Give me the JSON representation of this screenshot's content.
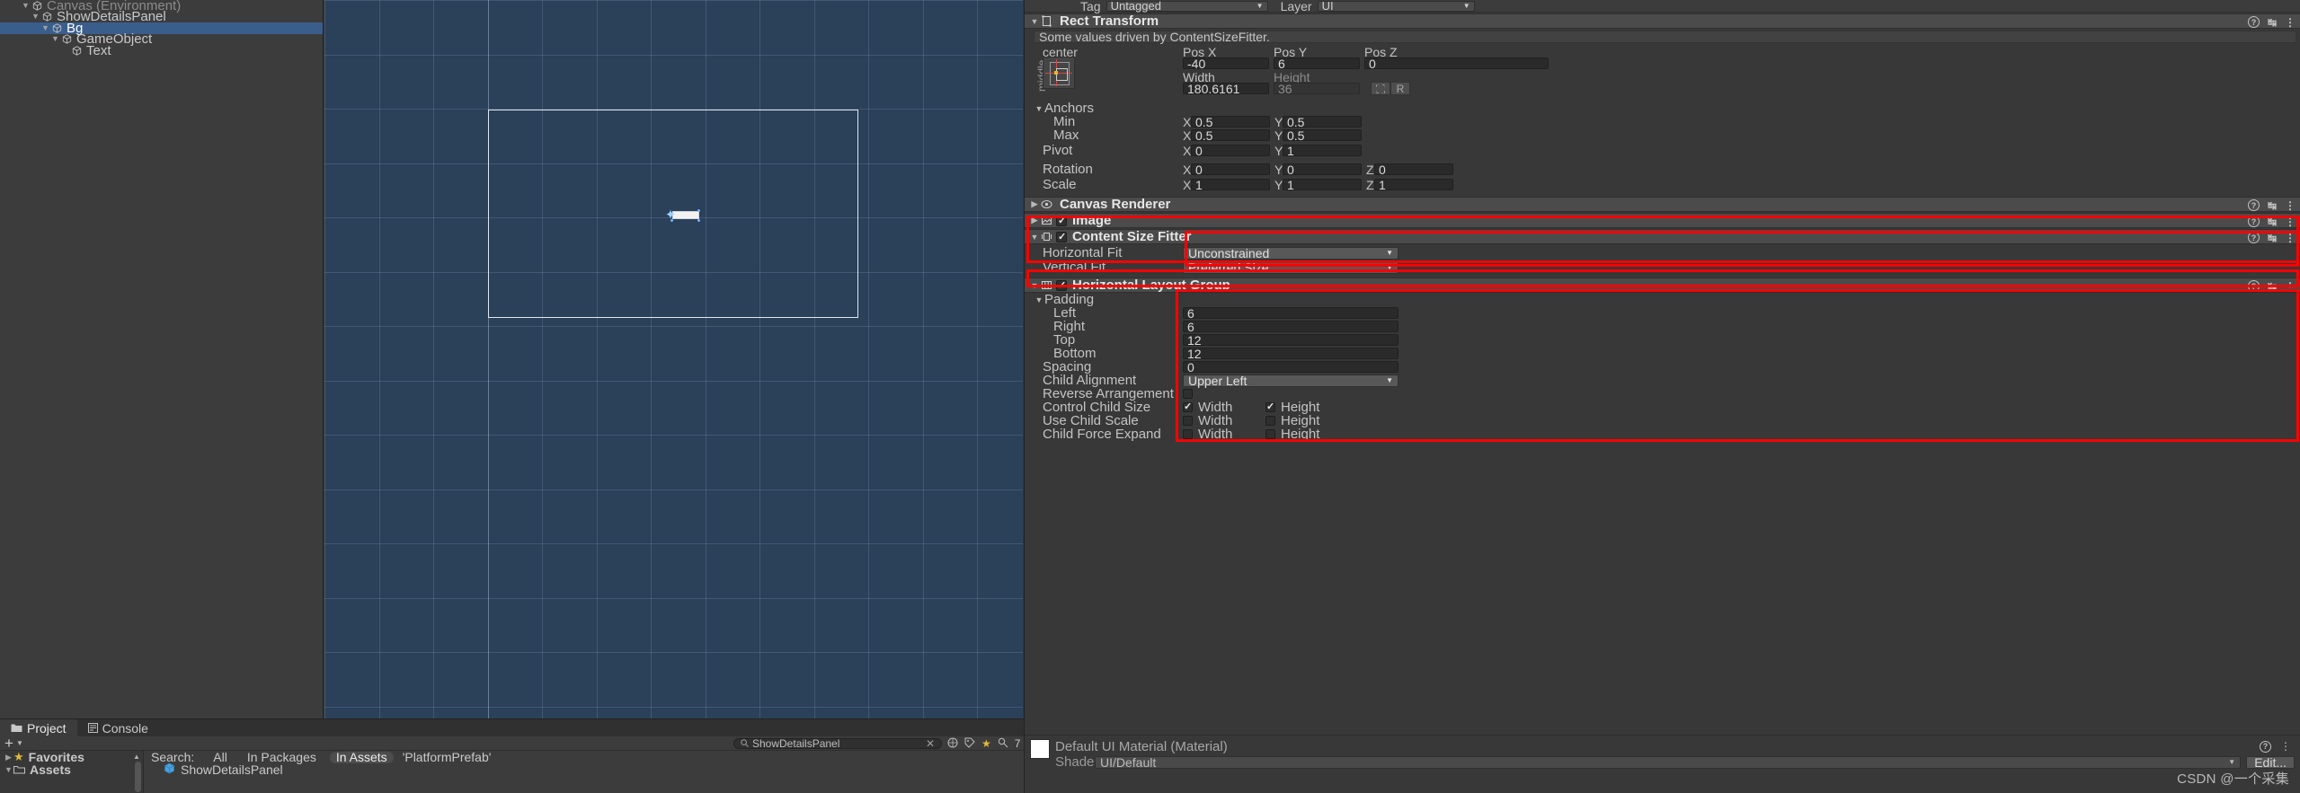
{
  "hierarchy": {
    "items": [
      {
        "label": "Canvas (Environment)",
        "depth": 1,
        "expanded": true,
        "selected": false,
        "dim": true
      },
      {
        "label": "ShowDetailsPanel",
        "depth": 2,
        "expanded": true,
        "selected": false,
        "dim": false
      },
      {
        "label": "Bg",
        "depth": 3,
        "expanded": true,
        "selected": true,
        "dim": false
      },
      {
        "label": "GameObject",
        "depth": 4,
        "expanded": true,
        "selected": false,
        "dim": false
      },
      {
        "label": "Text",
        "depth": 5,
        "expanded": false,
        "selected": false,
        "dim": false
      }
    ]
  },
  "inspector": {
    "tag_label": "Tag",
    "tag_value": "Untagged",
    "layer_label": "Layer",
    "layer_value": "UI",
    "rect_transform": {
      "title": "Rect Transform",
      "note": "Some values driven by ContentSizeFitter.",
      "anchor_preset_label": "center",
      "pos_x_label": "Pos X",
      "pos_x": "-40",
      "pos_y_label": "Pos Y",
      "pos_y": "6",
      "pos_z_label": "Pos Z",
      "pos_z": "0",
      "width_label": "Width",
      "width": "180.6161",
      "height_label": "Height",
      "height": "36",
      "blueprint_label": "",
      "raw_label": "R",
      "anchors_label": "Anchors",
      "min_label": "Min",
      "min_x": "0.5",
      "min_y": "0.5",
      "max_label": "Max",
      "max_x": "0.5",
      "max_y": "0.5",
      "pivot_label": "Pivot",
      "pivot_x": "0",
      "pivot_y": "1",
      "rotation_label": "Rotation",
      "rot_x": "0",
      "rot_y": "0",
      "rot_z": "0",
      "scale_label": "Scale",
      "scale_x": "1",
      "scale_y": "1",
      "scale_z": "1",
      "axis_x": "X",
      "axis_y": "Y",
      "axis_z": "Z"
    },
    "canvas_renderer": {
      "title": "Canvas Renderer"
    },
    "image": {
      "title": "Image",
      "enabled": true
    },
    "content_size_fitter": {
      "title": "Content Size Fitter",
      "enabled": true,
      "horizontal_fit_label": "Horizontal Fit",
      "horizontal_fit_value": "Unconstrained",
      "vertical_fit_label": "Vertical Fit",
      "vertical_fit_value": "Preferred Size"
    },
    "horizontal_layout_group": {
      "title": "Horizontal Layout Group",
      "enabled": true,
      "padding_label": "Padding",
      "left_label": "Left",
      "left": "6",
      "right_label": "Right",
      "right": "6",
      "top_label": "Top",
      "top": "12",
      "bottom_label": "Bottom",
      "bottom": "12",
      "spacing_label": "Spacing",
      "spacing": "0",
      "child_alignment_label": "Child Alignment",
      "child_alignment_value": "Upper Left",
      "reverse_arrangement_label": "Reverse Arrangement",
      "reverse_arrangement_checked": false,
      "control_child_size_label": "Control Child Size",
      "control_child_size_width": true,
      "control_child_size_height": true,
      "use_child_scale_label": "Use Child Scale",
      "use_child_scale_width": false,
      "use_child_scale_height": false,
      "child_force_expand_label": "Child Force Expand",
      "child_force_expand_width": false,
      "child_force_expand_height": false,
      "width_label": "Width",
      "height_label": "Height"
    },
    "material": {
      "title": "Default UI Material (Material)",
      "shader_label": "Shader",
      "shader_value": "UI/Default",
      "edit_label": "Edit..."
    }
  },
  "project": {
    "tabs": [
      {
        "label": "Project",
        "active": true,
        "icon": "folder-icon"
      },
      {
        "label": "Console",
        "active": false,
        "icon": "console-icon"
      }
    ],
    "add_label": "+",
    "favorites_label": "Favorites",
    "assets_label": "Assets",
    "search_label": "Search:",
    "filters": [
      {
        "label": "All",
        "active": false
      },
      {
        "label": "In Packages",
        "active": false
      },
      {
        "label": "In Assets",
        "active": true
      }
    ],
    "query_context": "'PlatformPrefab'",
    "result_item": "ShowDetailsPanel",
    "search_value": "ShowDetailsPanel",
    "search_placeholder": "Search",
    "count_badge": "7"
  },
  "watermark": "CSDN @一个采集",
  "colors": {
    "selection_blue": "#3a5e8c",
    "scene_bg": "#2b4059",
    "annotation_red": "#ff0000",
    "panel_bg": "#383838",
    "header_bg": "#4b4b4b"
  }
}
